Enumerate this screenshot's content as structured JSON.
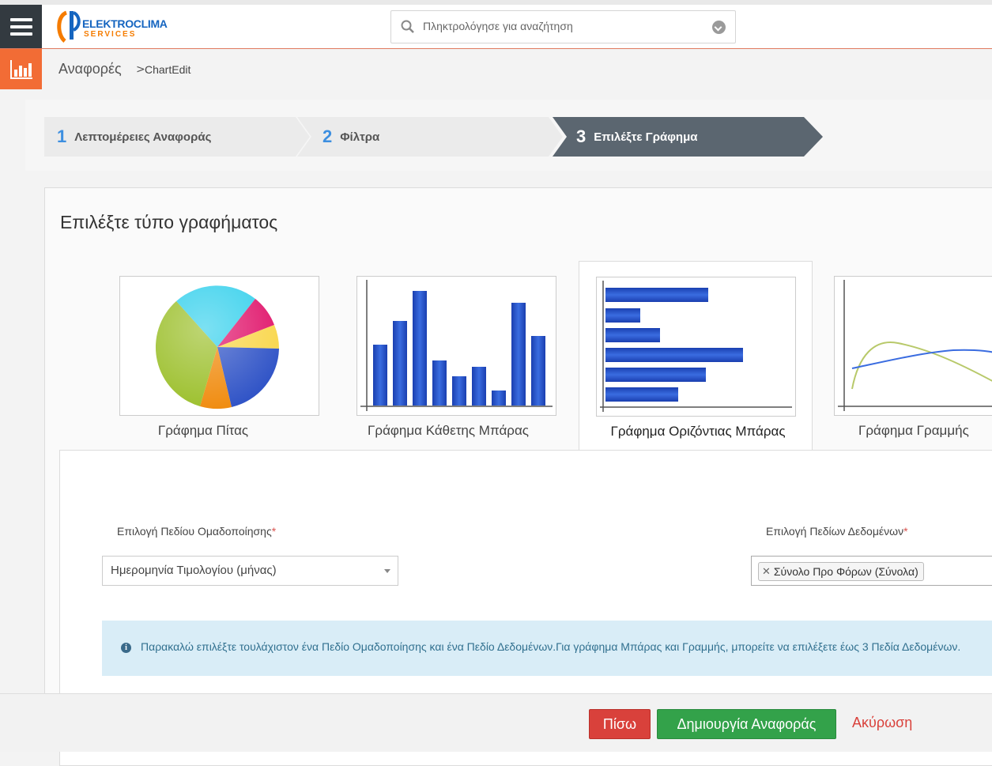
{
  "header": {
    "logo_top": "ELEKTRO",
    "logo_top2": "CLIMA",
    "logo_bottom": "SERVICES",
    "search_placeholder": "Πληκτρολόγησε για αναζήτηση"
  },
  "breadcrumb": {
    "root": "Αναφορές",
    "separator": ">",
    "current": "ChartEdit"
  },
  "wizard": {
    "steps": [
      {
        "num": "1",
        "label": "Λεπτομέρειες Αναφοράς",
        "active": false
      },
      {
        "num": "2",
        "label": "Φίλτρα",
        "active": false
      },
      {
        "num": "3",
        "label": "Επιλέξτε Γράφημα",
        "active": true
      }
    ]
  },
  "panel": {
    "title": "Επιλέξτε τύπο γραφήματος",
    "chart_types": [
      {
        "label": "Γράφημα Πίτας",
        "icon": "pie-chart-icon"
      },
      {
        "label": "Γράφημα Κάθετης Μπάρας",
        "icon": "vertical-bar-chart-icon"
      },
      {
        "label": "Γράφημα Οριζόντιας Μπάρας",
        "icon": "horizontal-bar-chart-icon",
        "selected": true
      },
      {
        "label": "Γράφημα Γραμμής",
        "icon": "line-chart-icon"
      }
    ]
  },
  "form": {
    "group_label": "Επιλογή Πεδίου Ομαδοποίησης",
    "group_value": "Ημερομηνία Τιμολογίου (μήνας)",
    "data_label": "Επιλογή Πεδίων Δεδομένων",
    "data_chip": "Σύνολο Προ Φόρων (Σύνολα)",
    "required_mark": "*",
    "info_text": "Παρακαλώ επιλέξτε τουλάχιστον ένα Πεδίο Ομαδοποίησης και ένα Πεδίο Δεδομένων.Για γράφημα Μπάρας και Γραμμής, μπορείτε να επιλέξετε έως 3 Πεδία Δεδομένων."
  },
  "footer": {
    "back": "Πίσω",
    "create": "Δημιουργία Αναφοράς",
    "cancel": "Ακύρωση"
  },
  "colors": {
    "accent_orange": "#f26c35",
    "active_step": "#5b6670",
    "step_number": "#3d8fe0",
    "back_button": "#d9413b",
    "create_button": "#33a24a",
    "info_bg": "#d9edf7"
  }
}
